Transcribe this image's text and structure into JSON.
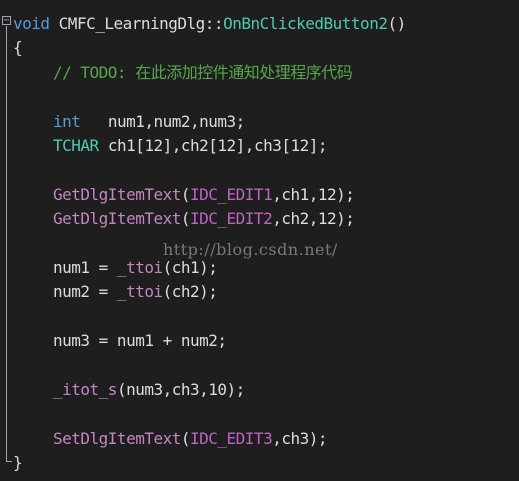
{
  "header": {
    "return_type": "void",
    "class_name": "CMFC_LearningDlg",
    "scope": "::",
    "method_name": "OnBnClickedButton2",
    "params": "()"
  },
  "open_brace": "{",
  "close_brace": "}",
  "comment": "// TODO: 在此添加控件通知处理程序代码",
  "decl_int": {
    "type": "int",
    "vars": "num1,num2,num3;"
  },
  "decl_tchar": {
    "type": "TCHAR",
    "vars": "ch1[12],ch2[12],ch3[12];"
  },
  "get1": {
    "func": "GetDlgItemText",
    "open": "(",
    "id": "IDC_EDIT1",
    "args": ",ch1,12);"
  },
  "get2": {
    "func": "GetDlgItemText",
    "open": "(",
    "id": "IDC_EDIT2",
    "args": ",ch2,12);"
  },
  "assign1": {
    "lhs": "num1 = ",
    "func": "_ttoi",
    "args": "(ch1);"
  },
  "assign2": {
    "lhs": "num2 = ",
    "func": "_ttoi",
    "args": "(ch2);"
  },
  "sum": "num3 = num1 + num2;",
  "itot": {
    "func": "_itot_s",
    "args": "(num3,ch3,10);"
  },
  "set": {
    "func": "SetDlgItemText",
    "open": "(",
    "id": "IDC_EDIT3",
    "args": ",ch3);"
  },
  "gutter": {
    "collapse_glyph": "−"
  },
  "watermark": "http://blog.csdn.net/",
  "colors": {
    "background": "#1e1e1e",
    "keyword": "#569cd6",
    "type": "#4ec9b0",
    "macro": "#bd63c5",
    "comment": "#57a64a",
    "text": "#dcdcdc"
  },
  "icons": [
    "collapse-icon"
  ]
}
